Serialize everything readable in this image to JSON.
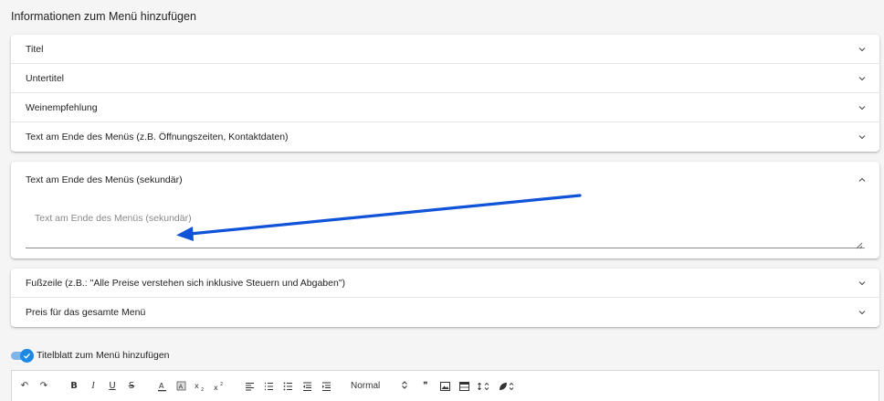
{
  "section": {
    "title": "Informationen zum Menü hinzufügen"
  },
  "panels_top": [
    {
      "label": "Titel"
    },
    {
      "label": "Untertitel"
    },
    {
      "label": "Weinempfehlung"
    },
    {
      "label": "Text am Ende des Menüs (z.B. Öffnungszeiten, Kontaktdaten)"
    }
  ],
  "panel_expanded": {
    "label": "Text am Ende des Menüs (sekundär)",
    "placeholder": "Text am Ende des Menüs (sekundär)",
    "value": ""
  },
  "panels_bottom": [
    {
      "label": "Fußzeile (z.B.: \"Alle Preise verstehen sich inklusive Steuern und Abgaben\")"
    },
    {
      "label": "Preis für das gesamte Menü"
    }
  ],
  "toggle": {
    "label": "Titelblatt zum Menü hinzufügen",
    "checked": true
  },
  "toolbar": {
    "undo": "↶",
    "redo": "↷",
    "bold": "B",
    "italic": "I",
    "underline": "U",
    "strike": "S",
    "format_select": "Normal",
    "quote": "❞"
  },
  "colors": {
    "accent": "#1e88e5",
    "annotation_arrow": "#1053d8"
  }
}
